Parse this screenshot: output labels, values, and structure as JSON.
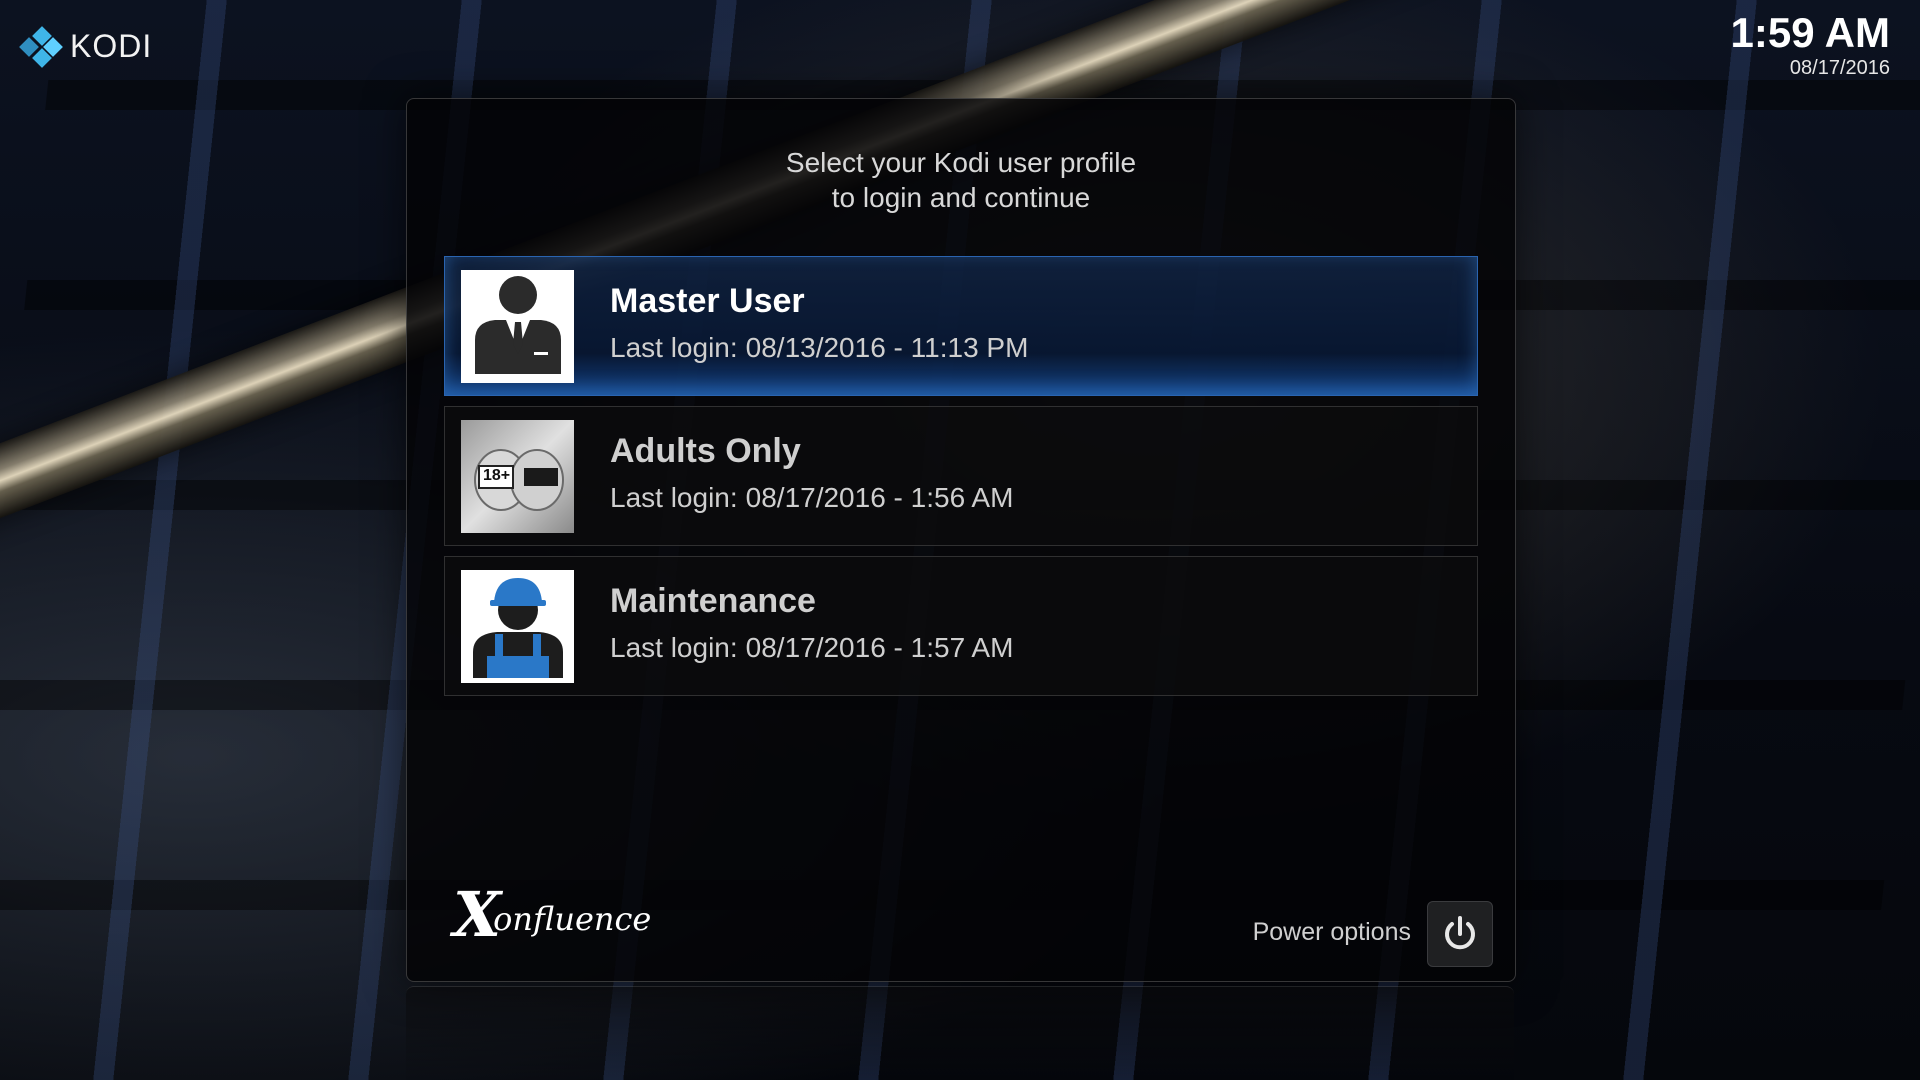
{
  "app": {
    "logo_text": "KODI",
    "brand_color": "#3fb5e8"
  },
  "clock": {
    "time": "1:59 AM",
    "date": "08/17/2016"
  },
  "dialog": {
    "heading_line1": "Select your Kodi user profile",
    "heading_line2": "to login and continue",
    "selected_color": "#2a64b0",
    "profiles": [
      {
        "name": "Master User",
        "last_login_label": "Last login:",
        "last_login_value": "08/13/2016 - 11:13 PM",
        "icon": "business-user-icon"
      },
      {
        "name": "Adults Only",
        "last_login_label": "Last login:",
        "last_login_value": "08/17/2016 - 1:56 AM",
        "icon": "adults-only-thumbnail",
        "avatar_badge": "18+"
      },
      {
        "name": "Maintenance",
        "last_login_label": "Last login:",
        "last_login_value": "08/17/2016 - 1:57 AM",
        "icon": "hardhat-worker-icon"
      }
    ],
    "skin_logo": {
      "x": "X",
      "rest": "onfluence"
    },
    "power_options_label": "Power options",
    "power_icon": "power-icon"
  }
}
